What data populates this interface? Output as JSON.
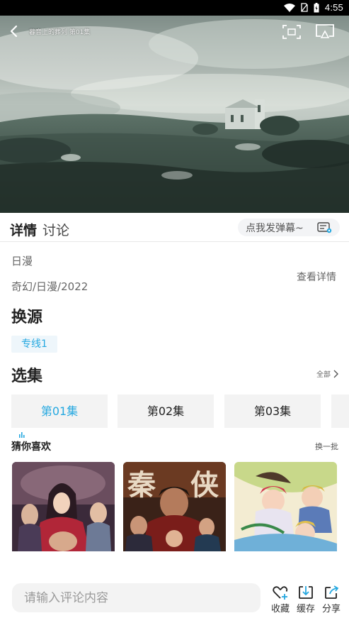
{
  "status_bar": {
    "time": "4:55"
  },
  "video": {
    "title": "暮音上的葬列 第01集"
  },
  "tabs": {
    "details": "详情",
    "discuss": "讨论"
  },
  "danmaku": {
    "placeholder": "点我发弹幕~"
  },
  "info": {
    "region": "日漫",
    "genres": "奇幻/日漫/2022",
    "view_details": "查看详情"
  },
  "source": {
    "heading": "换源",
    "selected": "专线1"
  },
  "episodes": {
    "heading": "选集",
    "all_label": "全部",
    "items": [
      "第01集",
      "第02集",
      "第03集"
    ]
  },
  "recommend": {
    "heading": "猜你喜欢",
    "refresh_label": "换一批"
  },
  "bottom_bar": {
    "comment_placeholder": "请输入评论内容",
    "favorite_label": "收藏",
    "cache_label": "缓存",
    "share_label": "分享"
  },
  "colors": {
    "accent": "#25a8e0"
  },
  "icons": [
    "back-icon",
    "pip-icon",
    "cast-icon",
    "danmaku-settings-icon",
    "chevron-right-icon",
    "playing-icon",
    "favorite-icon",
    "download-icon",
    "share-icon"
  ]
}
